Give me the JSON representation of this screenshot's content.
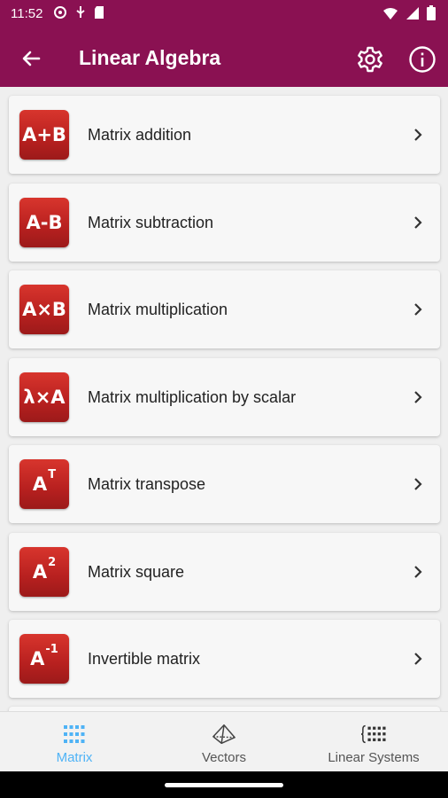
{
  "status_bar": {
    "time": "11:52"
  },
  "app_bar": {
    "title": "Linear Algebra"
  },
  "items": [
    {
      "badge": "A+B",
      "sup": "",
      "label": "Matrix addition"
    },
    {
      "badge": "A-B",
      "sup": "",
      "label": "Matrix subtraction"
    },
    {
      "badge": "A×B",
      "sup": "",
      "label": "Matrix multiplication"
    },
    {
      "badge": "λ×A",
      "sup": "",
      "label": "Matrix multiplication by scalar"
    },
    {
      "badge": "A",
      "sup": "T",
      "label": "Matrix transpose"
    },
    {
      "badge": "A",
      "sup": "2",
      "label": "Matrix square"
    },
    {
      "badge": "A",
      "sup": "-1",
      "label": "Invertible matrix"
    }
  ],
  "bottom_nav": {
    "items": [
      {
        "label": "Matrix",
        "icon": "matrix-grid-icon",
        "active": true
      },
      {
        "label": "Vectors",
        "icon": "pyramid-icon",
        "active": false
      },
      {
        "label": "Linear Systems",
        "icon": "braces-grid-icon",
        "active": false
      }
    ]
  },
  "colors": {
    "primary": "#8a1152",
    "badge": "#c0272d",
    "active_tab": "#4fb3f6"
  }
}
